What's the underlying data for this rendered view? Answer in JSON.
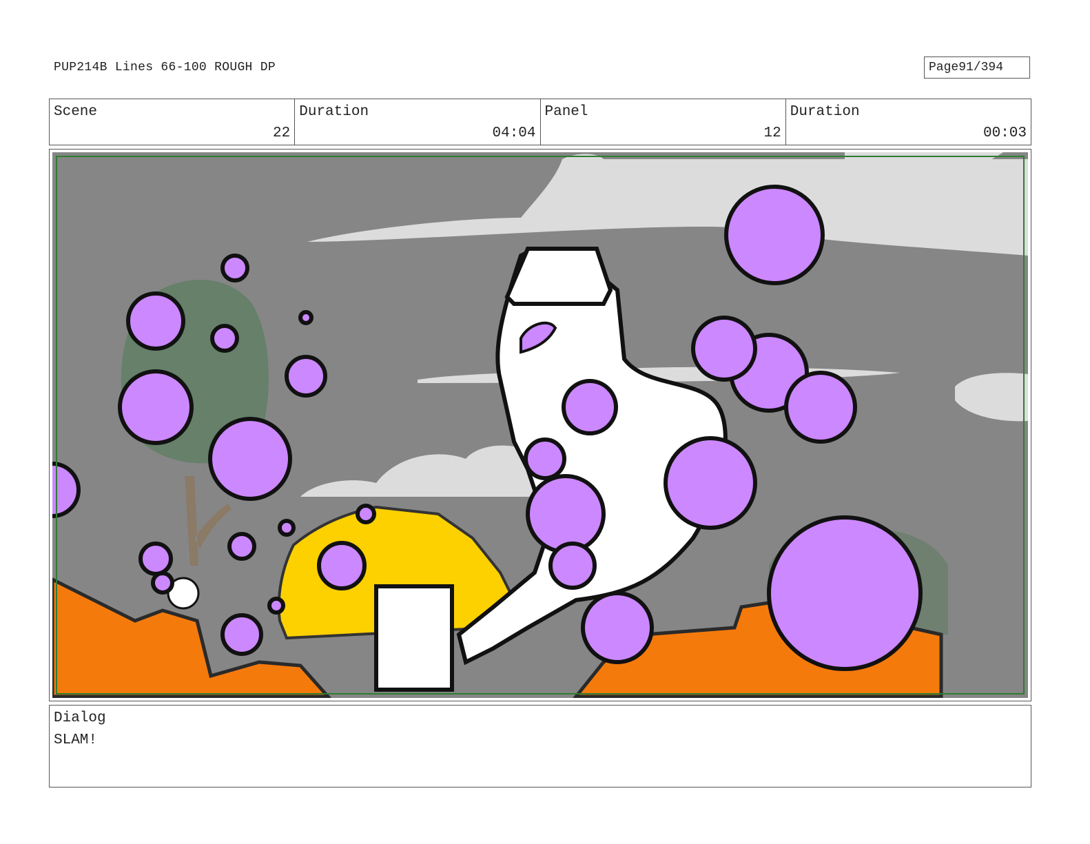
{
  "header": {
    "title": "PUP214B Lines 66-100 ROUGH DP",
    "page_label": "Page",
    "page_number": "91/394"
  },
  "info": {
    "scene_label": "Scene",
    "scene_value": "22",
    "scene_duration_label": "Duration",
    "scene_duration_value": "04:04",
    "panel_label": "Panel",
    "panel_value": "12",
    "panel_duration_label": "Duration",
    "panel_duration_value": "00:03"
  },
  "panel_image": {
    "description_icon": "storyboard-drawing",
    "colors": {
      "sky": "#868686",
      "cloud": "#dcdcdc",
      "gumball": "#cc88ff",
      "orange_debris": "#f57a0c",
      "yellow_vehicle": "#fdd000",
      "tree": "#66806a",
      "safe_frame": "#2e7d32"
    }
  },
  "dialog": {
    "label": "Dialog",
    "text": "SLAM!"
  }
}
